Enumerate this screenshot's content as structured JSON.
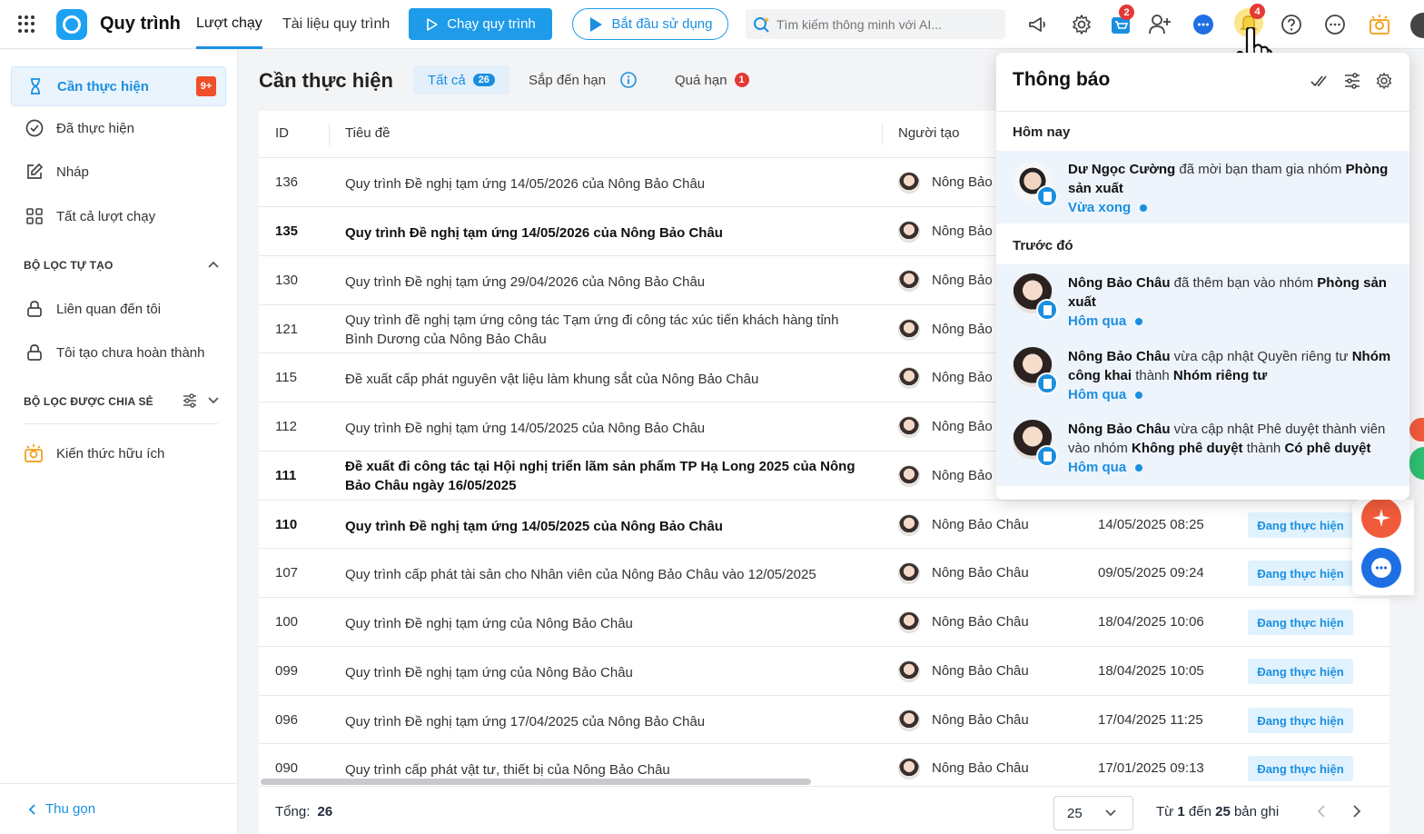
{
  "header": {
    "app_title": "Quy trình",
    "tabs": [
      "Lượt chạy",
      "Tài liệu quy trình"
    ],
    "run_button": "Chạy quy trình",
    "start_button": "Bắt đầu sử dụng",
    "search_placeholder": "Tìm kiếm thông minh với AI...",
    "cart_badge": "2",
    "bell_badge": "4"
  },
  "sidebar": {
    "items": [
      {
        "label": "Cần thực hiện",
        "count": "9+"
      },
      {
        "label": "Đã thực hiện"
      },
      {
        "label": "Nháp"
      },
      {
        "label": "Tất cả lượt chạy"
      }
    ],
    "section_custom": "BỘ LỌC TỰ TẠO",
    "custom_items": [
      "Liên quan đến tôi",
      "Tôi tạo chưa hoàn thành"
    ],
    "section_shared": "BỘ LỌC ĐƯỢC CHIA SẺ",
    "knowledge": "Kiến thức hữu ích",
    "collapse": "Thu gọn"
  },
  "main": {
    "title": "Cần thực hiện",
    "filters": [
      {
        "label": "Tất cả",
        "count": "26"
      },
      {
        "label": "Sắp đến hạn"
      },
      {
        "label": "Quá hạn",
        "count": "1"
      }
    ],
    "columns": {
      "id": "ID",
      "title": "Tiêu đề",
      "creator": "Người tạo"
    },
    "rows": [
      {
        "id": "136",
        "title": "Quy trình Đề nghị tạm ứng 14/05/2026 của Nông Bảo Châu",
        "creator": "Nông Bảo",
        "date": "",
        "status": ""
      },
      {
        "id": "135",
        "title": "Quy trình Đề nghị tạm ứng 14/05/2026 của Nông Bảo Châu",
        "creator": "Nông Bảo",
        "date": "",
        "status": ""
      },
      {
        "id": "130",
        "title": "Quy trình Đề nghị tạm ứng 29/04/2026 của Nông Bảo Châu",
        "creator": "Nông Bảo",
        "date": "",
        "status": ""
      },
      {
        "id": "121",
        "title": "Quy trình đề nghị tạm ứng công tác Tạm ứng đi công tác xúc tiến khách hàng tỉnh Bình Dương của Nông Bảo Châu",
        "creator": "Nông Bảo",
        "date": "",
        "status": ""
      },
      {
        "id": "115",
        "title": "Đề xuất cấp phát nguyên vật liệu làm khung sắt của Nông Bảo Châu",
        "creator": "Nông Bảo",
        "date": "",
        "status": ""
      },
      {
        "id": "112",
        "title": "Quy trình Đề nghị tạm ứng 14/05/2025 của Nông Bảo Châu",
        "creator": "Nông Bảo",
        "date": "",
        "status": ""
      },
      {
        "id": "111",
        "title": "Đề xuất đi công tác tại Hội nghị triển lãm sản phẩm TP Hạ Long 2025 của Nông Bảo Châu ngày 16/05/2025",
        "creator": "Nông Bảo",
        "date": "",
        "status": ""
      },
      {
        "id": "110",
        "title": "Quy trình Đề nghị tạm ứng 14/05/2025 của Nông Bảo Châu",
        "creator": "Nông Bảo Châu",
        "date": "14/05/2025 08:25",
        "status": "Đang thực hiện"
      },
      {
        "id": "107",
        "title": "Quy trình cấp phát tài sản cho Nhân viên của Nông Bảo Châu vào 12/05/2025",
        "creator": "Nông Bảo Châu",
        "date": "09/05/2025 09:24",
        "status": "Đang thực hiện"
      },
      {
        "id": "100",
        "title": "Quy trình Đề nghị tạm ứng của Nông Bảo Châu",
        "creator": "Nông Bảo Châu",
        "date": "18/04/2025 10:06",
        "status": "Đang thực hiện"
      },
      {
        "id": "099",
        "title": "Quy trình Đề nghị tạm ứng của Nông Bảo Châu",
        "creator": "Nông Bảo Châu",
        "date": "18/04/2025 10:05",
        "status": "Đang thực hiện"
      },
      {
        "id": "096",
        "title": "Quy trình Đề nghị tạm ứng 17/04/2025 của Nông Bảo Châu",
        "creator": "Nông Bảo Châu",
        "date": "17/04/2025 11:25",
        "status": "Đang thực hiện"
      },
      {
        "id": "090",
        "title": "Quy trình cấp phát vật tư, thiết bị của Nông Bảo Châu",
        "creator": "Nông Bảo Châu",
        "date": "17/01/2025 09:13",
        "status": "Đang thực hiện"
      }
    ],
    "footer": {
      "total_label": "Tổng:",
      "total": "26",
      "per_page": "25",
      "range": {
        "from_word": "Từ",
        "from": "1",
        "to_word": "đến",
        "to": "25",
        "suffix": "bản ghi"
      }
    }
  },
  "notifications": {
    "title": "Thông báo",
    "today_label": "Hôm nay",
    "earlier_label": "Trước đó",
    "today": [
      {
        "actor": "Dư Ngọc Cường",
        "action": "đã mời bạn tham gia nhóm",
        "target": "Phòng sản xuất",
        "time": "Vừa xong"
      }
    ],
    "earlier": [
      {
        "actor": "Nông Bảo Châu",
        "action": "đã thêm bạn vào nhóm",
        "target": "Phòng sản xuất",
        "extra1": "",
        "extra2": "",
        "time": "Hôm qua"
      },
      {
        "actor": "Nông Bảo Châu",
        "action": "vừa cập nhật Quyền riêng tư",
        "target": "Nhóm công khai",
        "extra1": "thành",
        "extra2": "Nhóm riêng tư",
        "time": "Hôm qua"
      },
      {
        "actor": "Nông Bảo Châu",
        "action": "vừa cập nhật Phê duyệt thành viên vào nhóm",
        "target": "Không phê duyệt",
        "extra1": "thành",
        "extra2": "Có phê duyệt",
        "time": "Hôm qua"
      }
    ]
  }
}
